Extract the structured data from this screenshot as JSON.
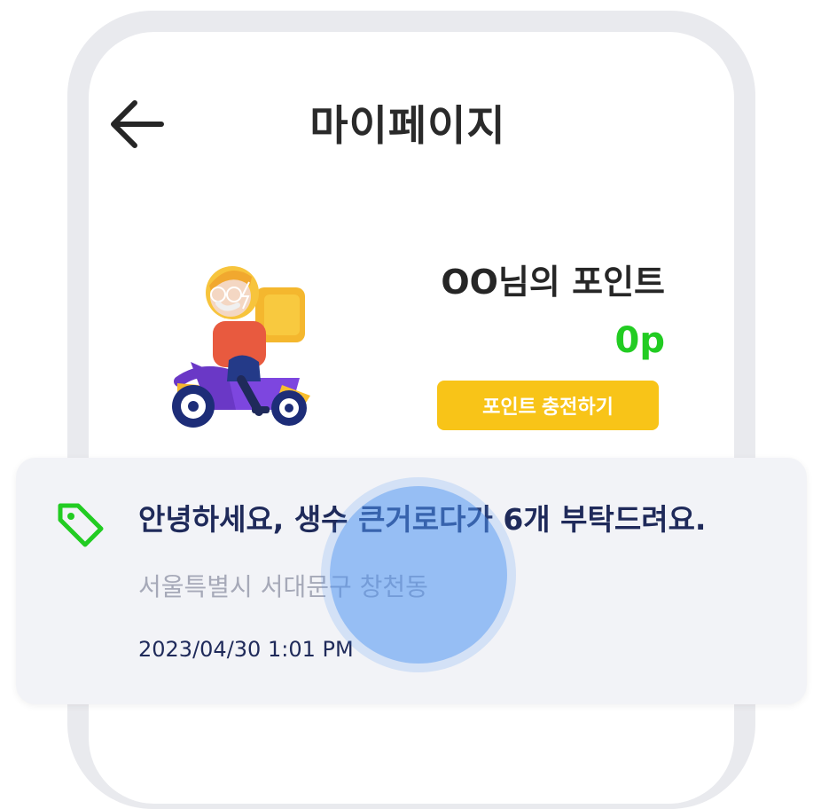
{
  "header": {
    "title": "마이페이지",
    "back_icon": "arrow-left-icon"
  },
  "profile": {
    "illustration": "delivery-scooter-rider",
    "points_title": "OO님의 포인트",
    "points_value": "0p",
    "charge_button_label": "포인트 충전하기"
  },
  "notice": {
    "icon": "tag-icon",
    "title": "안녕하세요, 생수 큰거로다가 6개 부탁드려요.",
    "address": "서울특별시 서대문구 창천동",
    "datetime": "2023/04/30  1:01 PM"
  },
  "colors": {
    "accent_green": "#22cc22",
    "button_yellow": "#f8c418",
    "navy_text": "#1f2a5a",
    "gray_text": "#a6a9b8",
    "frame_gray": "#e9eaee",
    "card_bg": "#f2f3f7",
    "touch_blue": "#4a92f2"
  }
}
